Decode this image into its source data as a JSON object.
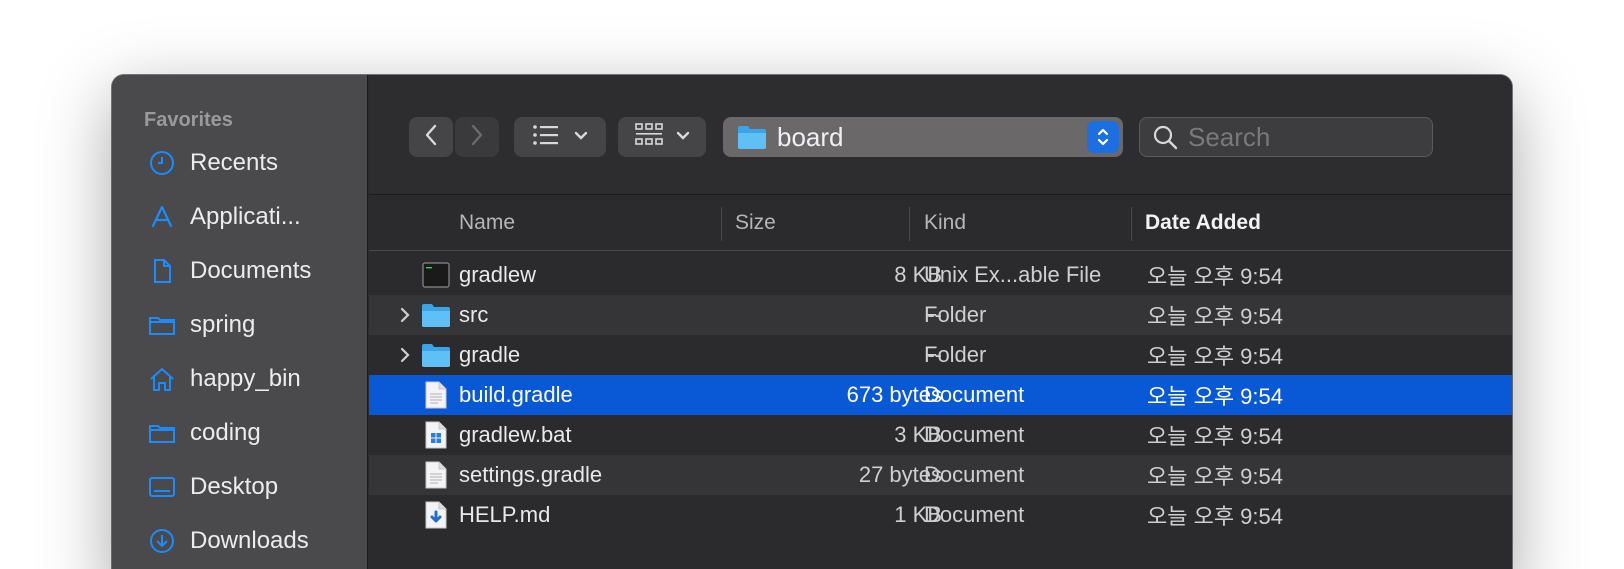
{
  "sidebar": {
    "heading": "Favorites",
    "items": [
      {
        "label": "Recents",
        "icon": "clock-icon"
      },
      {
        "label": "Applicati...",
        "icon": "applications-icon"
      },
      {
        "label": "Documents",
        "icon": "document-icon"
      },
      {
        "label": "spring",
        "icon": "folder-icon"
      },
      {
        "label": "happy_bin",
        "icon": "home-icon"
      },
      {
        "label": "coding",
        "icon": "folder-icon"
      },
      {
        "label": "Desktop",
        "icon": "desktop-icon"
      },
      {
        "label": "Downloads",
        "icon": "download-icon"
      }
    ]
  },
  "toolbar": {
    "path": "board",
    "search_placeholder": "Search"
  },
  "columns": {
    "name": "Name",
    "size": "Size",
    "kind": "Kind",
    "date": "Date Added"
  },
  "files": [
    {
      "name": "gradlew",
      "size": "8 KB",
      "kind": "Unix Ex...able File",
      "date": "오늘 오후 9:54",
      "icon": "terminal-file-icon",
      "expandable": false,
      "selected": false
    },
    {
      "name": "src",
      "size": "--",
      "kind": "Folder",
      "date": "오늘 오후 9:54",
      "icon": "folder-icon",
      "expandable": true,
      "selected": false
    },
    {
      "name": "gradle",
      "size": "--",
      "kind": "Folder",
      "date": "오늘 오후 9:54",
      "icon": "folder-icon",
      "expandable": true,
      "selected": false
    },
    {
      "name": "build.gradle",
      "size": "673 bytes",
      "kind": "Document",
      "date": "오늘 오후 9:54",
      "icon": "document-icon",
      "expandable": false,
      "selected": true
    },
    {
      "name": "gradlew.bat",
      "size": "3 KB",
      "kind": "Document",
      "date": "오늘 오후 9:54",
      "icon": "windows-file-icon",
      "expandable": false,
      "selected": false
    },
    {
      "name": "settings.gradle",
      "size": "27 bytes",
      "kind": "Document",
      "date": "오늘 오후 9:54",
      "icon": "document-icon",
      "expandable": false,
      "selected": false
    },
    {
      "name": "HELP.md",
      "size": "1 KB",
      "kind": "Document",
      "date": "오늘 오후 9:54",
      "icon": "markdown-file-icon",
      "expandable": false,
      "selected": false
    }
  ],
  "colors": {
    "accent": "#1a8cff",
    "selection": "#0958d5"
  }
}
